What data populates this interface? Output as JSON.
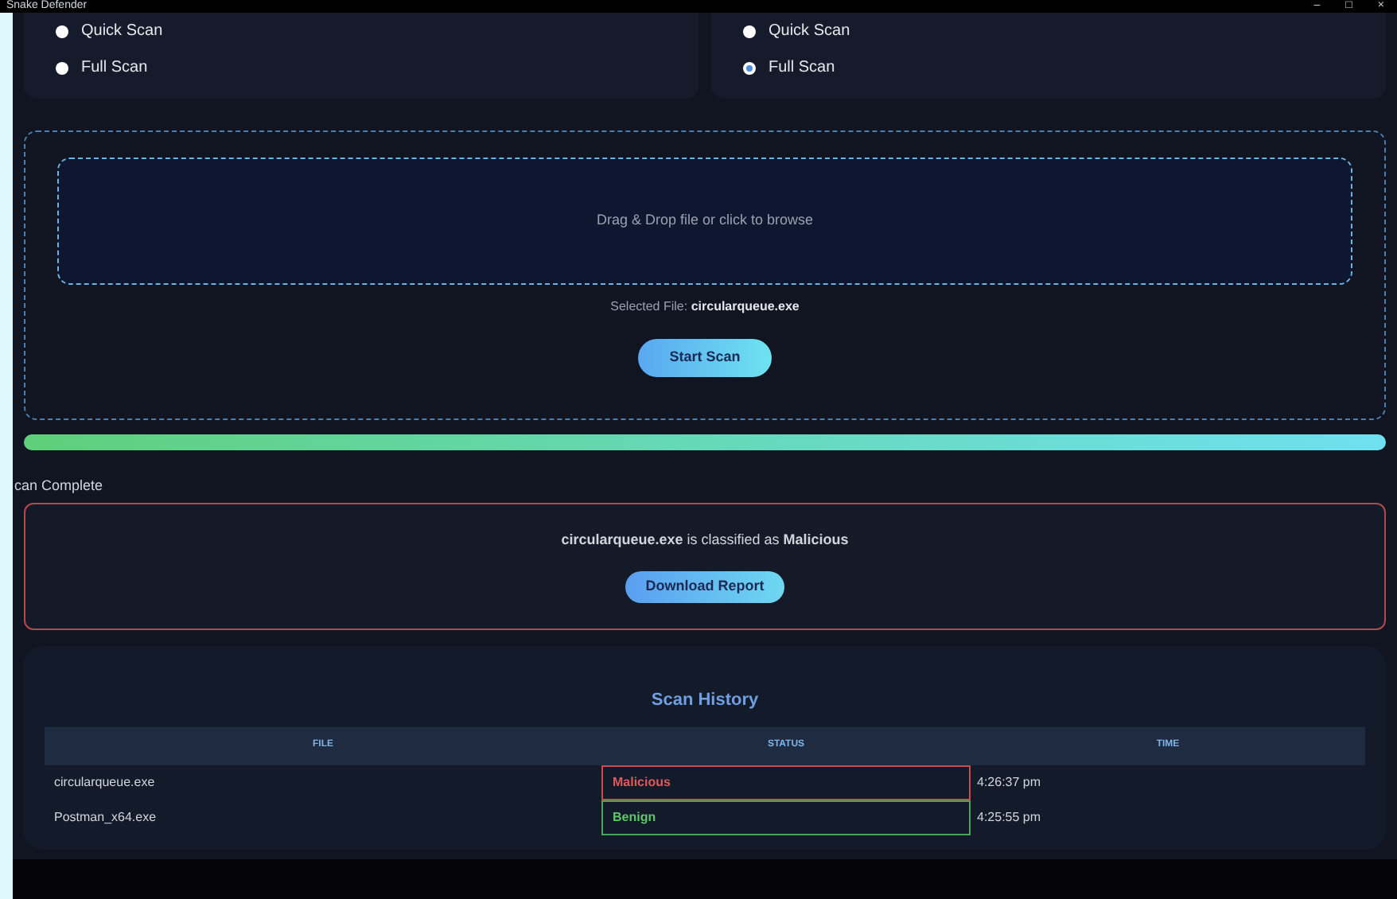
{
  "window": {
    "title": "Snake Defender",
    "controls": [
      "–",
      "□",
      "×"
    ]
  },
  "scan_groups": [
    {
      "options": [
        {
          "label": "Quick Scan",
          "selected": false
        },
        {
          "label": "Full Scan",
          "selected": false
        }
      ]
    },
    {
      "options": [
        {
          "label": "Quick Scan",
          "selected": false
        },
        {
          "label": "Full Scan",
          "selected": true
        }
      ]
    }
  ],
  "dropzone": {
    "prompt": "Drag & Drop file or click to browse",
    "selected_label": "Selected File: ",
    "selected_file": "circularqueue.exe",
    "button": "Start Scan"
  },
  "progress": {
    "level": 1,
    "status": "can Complete"
  },
  "result": {
    "text": "**circularqueue.exe** is classified as **Malicious**",
    "alert": true,
    "button": "Download Report"
  },
  "history": {
    "title": "Scan History",
    "columns": [
      "FILE",
      "STATUS",
      "TIME"
    ],
    "rows": [
      {
        "file": "circularqueue.exe",
        "status": "Malicious",
        "kind": "malicious",
        "time": "4:26:37 pm"
      },
      {
        "file": "Postman_x64.exe",
        "status": "Benign",
        "kind": "benign",
        "time": "4:25:55 pm"
      }
    ]
  }
}
